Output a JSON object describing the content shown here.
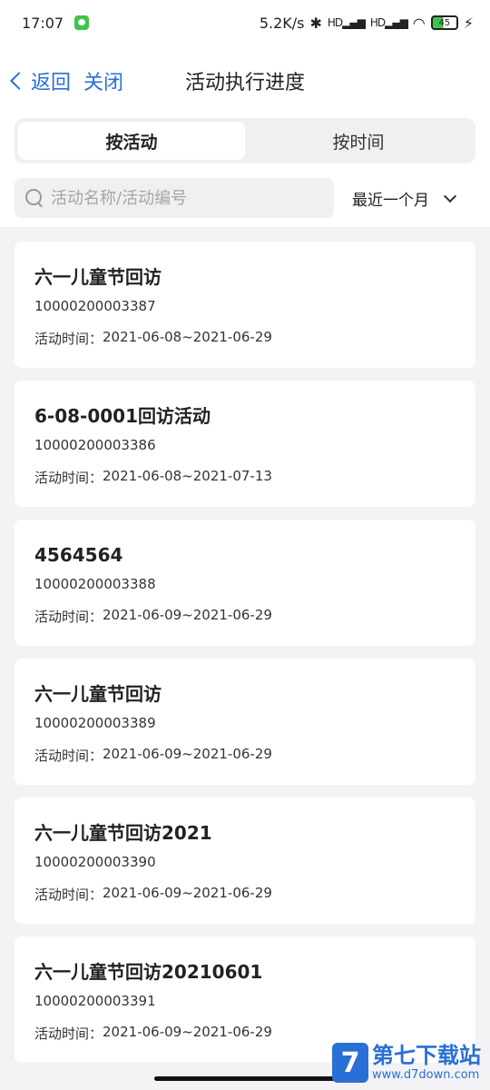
{
  "status_bar": {
    "time": "17:07",
    "network_speed": "5.2K/s",
    "signal1": "HD",
    "signal2": "HD",
    "battery": "45",
    "battery_level_pct": 45
  },
  "nav": {
    "back_label": "返回",
    "close_label": "关闭",
    "title": "活动执行进度"
  },
  "tabs": [
    {
      "label": "按活动",
      "active": true
    },
    {
      "label": "按时间",
      "active": false
    }
  ],
  "search": {
    "placeholder": "活动名称/活动编号",
    "value": ""
  },
  "filter": {
    "selected": "最近一个月"
  },
  "activities": [
    {
      "title": "六一儿童节回访",
      "code": "10000200003387",
      "time_label": "活动时间：",
      "time_range": "2021-06-08~2021-06-29"
    },
    {
      "title": "6-08-0001回访活动",
      "code": "10000200003386",
      "time_label": "活动时间：",
      "time_range": "2021-06-08~2021-07-13"
    },
    {
      "title": "4564564",
      "code": "10000200003388",
      "time_label": "活动时间：",
      "time_range": "2021-06-09~2021-06-29"
    },
    {
      "title": "六一儿童节回访",
      "code": "10000200003389",
      "time_label": "活动时间：",
      "time_range": "2021-06-09~2021-06-29"
    },
    {
      "title": "六一儿童节回访2021",
      "code": "10000200003390",
      "time_label": "活动时间：",
      "time_range": "2021-06-09~2021-06-29"
    },
    {
      "title": "六一儿童节回访20210601",
      "code": "10000200003391",
      "time_label": "活动时间：",
      "time_range": "2021-06-09~2021-06-29"
    }
  ],
  "watermark": {
    "logo_char": "7",
    "name": "第七下载站",
    "url": "www.d7down.com"
  },
  "colors": {
    "accent": "#2a6fd6",
    "background": "#f3f3f5"
  }
}
